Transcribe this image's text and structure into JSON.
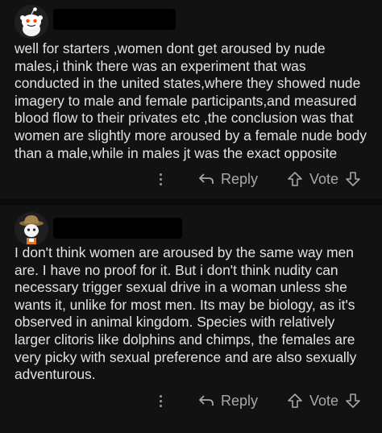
{
  "comments": [
    {
      "avatar_icon": "snoo-avatar-icon",
      "body_lines": [
        "well for starters ,women dont get aroused by nude",
        "males,i think there was an experiment that was",
        "conducted in the united states,where they showed nude",
        "imagery to male and female participants,and measured",
        "blood flow to their privates etc ,the conclusion was that",
        "women are slightly more aroused by a female nude body",
        "than a male,while in males jt was the exact opposite"
      ],
      "reply_label": "Reply",
      "vote_label": "Vote"
    },
    {
      "avatar_icon": "explorer-avatar-icon",
      "body_lines": [
        "I don't think women are aroused by the same way men",
        "are. I have no proof for it. But i don't think nudity can",
        "necessary trigger sexual drive in a woman unless she",
        "wants it, unlike for most men. Its may be biology, as it's",
        "observed in animal kingdom. Species with relatively",
        "larger clitoris like dolphins and chimps, the females are",
        "very picky with sexual preference and are also sexually",
        "adventurous."
      ],
      "reply_label": "Reply",
      "vote_label": "Vote"
    }
  ],
  "colors": {
    "background": "#0b0b0b",
    "card": "#121212",
    "text": "#e2e2e2",
    "muted": "#a8a8a8"
  }
}
